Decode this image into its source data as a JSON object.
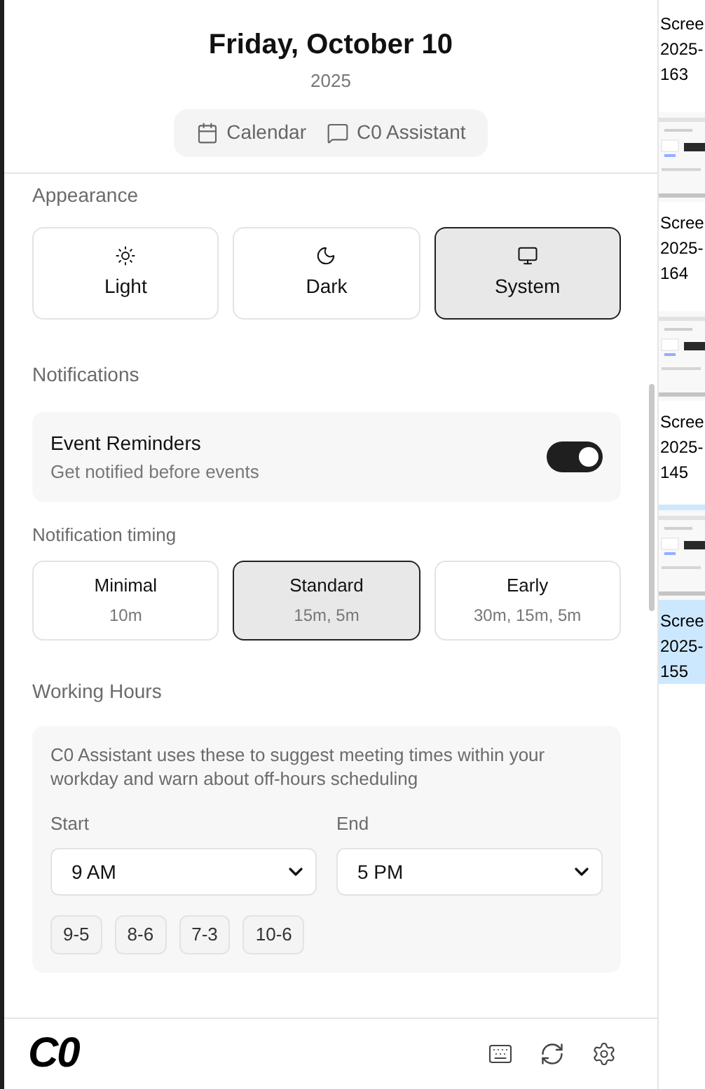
{
  "header": {
    "title": "Friday, October 10",
    "year": "2025"
  },
  "tabs": [
    {
      "label": "Calendar",
      "selected": false
    },
    {
      "label": "C0 Assistant",
      "selected": false
    }
  ],
  "appearance": {
    "heading": "Appearance",
    "options": [
      {
        "label": "Light",
        "selected": false
      },
      {
        "label": "Dark",
        "selected": false
      },
      {
        "label": "System",
        "selected": true
      }
    ]
  },
  "notifications": {
    "heading": "Notifications",
    "reminder": {
      "title": "Event Reminders",
      "description": "Get notified before events",
      "on": true
    },
    "timing_label": "Notification timing",
    "timings": [
      {
        "label": "Minimal",
        "detail": "10m",
        "selected": false
      },
      {
        "label": "Standard",
        "detail": "15m, 5m",
        "selected": true
      },
      {
        "label": "Early",
        "detail": "30m, 15m, 5m",
        "selected": false
      }
    ]
  },
  "working_hours": {
    "heading": "Working Hours",
    "description": "C0 Assistant uses these to suggest meeting times within your workday and warn about off-hours scheduling",
    "start_label": "Start",
    "start_value": "9 AM",
    "end_label": "End",
    "end_value": "5 PM",
    "presets": [
      "9-5",
      "8-6",
      "7-3",
      "10-6"
    ]
  },
  "footer": {
    "logo": "C0"
  },
  "files": [
    {
      "lines": [
        "Scree",
        "2025-",
        "163"
      ],
      "thumbnail": false,
      "selected": false
    },
    {
      "lines": [
        "Scree",
        "2025-",
        "164"
      ],
      "thumbnail": true,
      "selected": false
    },
    {
      "lines": [
        "Scree",
        "2025-",
        "145"
      ],
      "thumbnail": true,
      "selected": false
    },
    {
      "lines": [
        "Scree",
        "2025-",
        "155"
      ],
      "thumbnail": true,
      "selected": true
    }
  ]
}
